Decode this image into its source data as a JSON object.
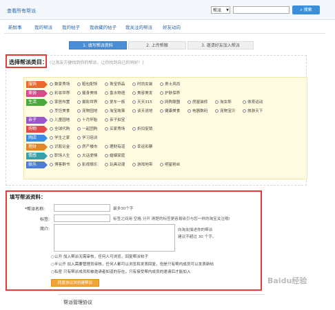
{
  "topbar": {
    "view_all_link": "查看所有帮派",
    "select_value": "帮派",
    "search_button": "搜索"
  },
  "nav": [
    "新鲜事",
    "我的帮派",
    "我的帖子",
    "我收藏的帖子",
    "我关注的帮派",
    "好友动向"
  ],
  "steps": [
    "1. 填写帮派资料",
    "2. 上传帮徽",
    "3. 邀请好友加入帮派"
  ],
  "category": {
    "title": "选择帮派类目：",
    "hint": "(让淘友方便找到你的帮派，让你找到自己的同好！)",
    "rows": [
      {
        "tag": "服饰",
        "color": "#e86a2c",
        "options": [
          "数家秀场",
          "鞋包配饰",
          "珠宝饰品",
          "时尚女装",
          "男士风尚"
        ]
      },
      {
        "tag": "美容",
        "color": "#d84a8c",
        "options": [
          "彩妆世界",
          "瘦身美体",
          "香水物语",
          "美容美发",
          "护肤保养"
        ]
      },
      {
        "tag": "生活",
        "color": "#4aa83c",
        "options": [
          "家居布置",
          "摄影世界",
          "爱车一族",
          "天天315",
          "网购联盟",
          "房屋装修",
          "淘女郎",
          "体育运动"
        ]
      },
      {
        "tag": "",
        "color": "",
        "options": [
          "烹饪美食",
          "宠物园地",
          "淘宝故事",
          "谈天说地",
          "健康美食",
          "电器数码",
          "宠物宝贝",
          "旅游天下"
        ]
      },
      {
        "tag": "亲子",
        "color": "#9a55c8",
        "options": [
          "儿童园地",
          "十月怀胎",
          "亲子拍宝"
        ]
      },
      {
        "tag": "购物",
        "color": "#e04a4a",
        "options": [
          "全球代购",
          "一起团购",
          "买家秀场",
          "折扣促销"
        ]
      },
      {
        "tag": "网店",
        "color": "#3a8fd8",
        "options": [
          "学生之家",
          "学习培训"
        ]
      },
      {
        "tag": "理财",
        "color": "#e0862c",
        "options": [
          "识股论金",
          "房产楼市",
          "理财有道",
          "幸运彩票"
        ]
      },
      {
        "tag": "情感",
        "color": "#3aa0a8",
        "options": [
          "职场人生",
          "大话爱情",
          "婚姻家庭"
        ]
      },
      {
        "tag": "娱乐",
        "color": "#4a7cd8",
        "options": [
          "博客群书",
          "影视娱乐",
          "玩具动漫",
          "游戏地带",
          "明星粉丝"
        ]
      }
    ]
  },
  "form": {
    "title": "填写帮派资料：",
    "name_label": "*帮派名称:",
    "name_note": "最多30个字",
    "tags_label": "标签:",
    "tags_note": "标签之间用 空格 分开 清楚的标签更容易吸引与您一样的淘宝关注哦!",
    "intro_label": "简介:",
    "intro_note_1": "向淘友描述你的帮派",
    "intro_note_2": "建议不超过 30 个字。",
    "privacy_options": [
      "○公开    加入帮派无需审核，任何人可浏览，回复帮派帖子",
      "○半公开   加入需要管理员审核，任何人都可以浏览和发表回复，但是只有帮内成员可以发表新帖",
      "○私密    只有帮派成员和被邀请者知道的存在，只有接受帮内成员的邀请后才能加入"
    ],
    "submit_button": "同意协议并创建帮派"
  },
  "agreement": "帮派管理协议",
  "watermark": "Baidu经验"
}
